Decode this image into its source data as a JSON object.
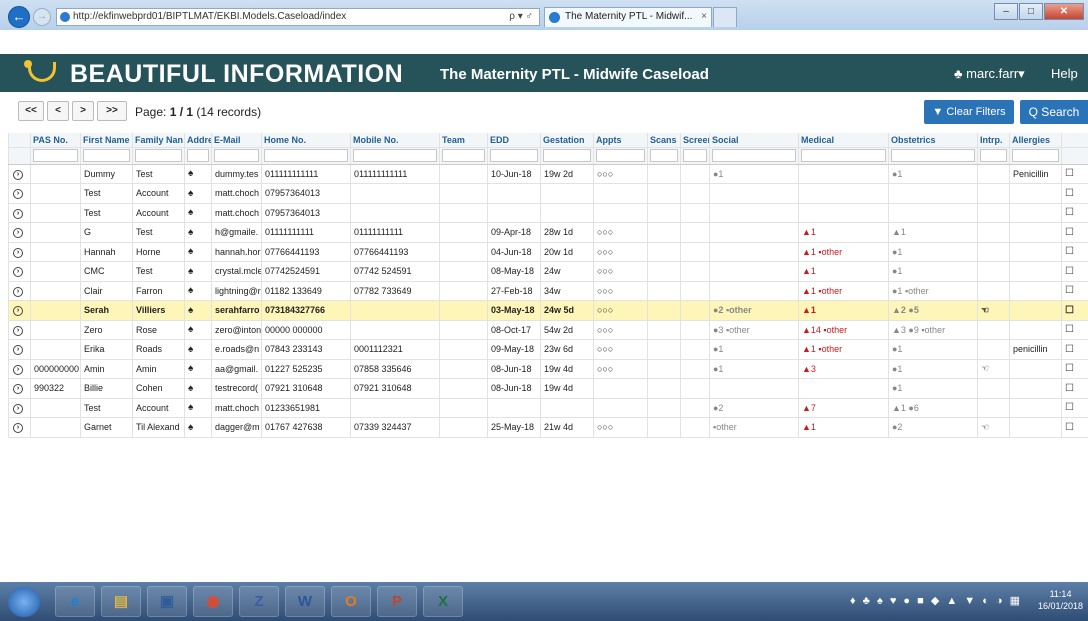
{
  "browser": {
    "url": "http://ekfinwebprd01/BIPTLMAT/EKBI.Models.Caseload/index",
    "tab_title": "The Maternity PTL - Midwif...",
    "address_controls": "ρ ▾ ♂",
    "tab_close": "×",
    "window_buttons": {
      "minimize": "–",
      "maximize": "□",
      "close": "✕"
    }
  },
  "app": {
    "brand": "BEAUTIFUL INFORMATION",
    "subtitle": "The Maternity PTL - Midwife Caseload",
    "user": "♣ marc.farr▾",
    "help": "Help"
  },
  "pager": {
    "first": "<<",
    "prev": "<",
    "next": ">",
    "last": ">>",
    "page_label": "Page:",
    "page_value": "1 / 1",
    "records": "(14 records)"
  },
  "toolbar": {
    "clear_filters": "▼ Clear Filters",
    "search": "Q Search"
  },
  "columns": [
    "",
    "PAS No.",
    "First Name",
    "Family Nan",
    "Addres",
    "E-Mail",
    "Home No.",
    "Mobile No.",
    "Team",
    "EDD",
    "Gestation",
    "Appts",
    "Scans",
    "Screen",
    "Social",
    "Medical",
    "Obstetrics",
    "Intrp.",
    "Allergies",
    ""
  ],
  "rows": [
    {
      "pas": "",
      "first": "Dummy",
      "family": "Test",
      "email": "dummy.tes",
      "home": "011111111111",
      "mobile": "011111111111",
      "edd": "10-Jun-18",
      "gest": "19w 2d",
      "appts": "○○○",
      "social": "●1",
      "medical": "",
      "obstetrics": "●1",
      "intrp": "",
      "allergies": "Penicillin",
      "highlight": false
    },
    {
      "pas": "",
      "first": "Test",
      "family": "Account",
      "email": "matt.choch",
      "home": "07957364013",
      "mobile": "",
      "edd": "",
      "gest": "",
      "appts": "",
      "social": "",
      "medical": "",
      "obstetrics": "",
      "intrp": "",
      "allergies": "",
      "highlight": false
    },
    {
      "pas": "",
      "first": "Test",
      "family": "Account",
      "email": "matt.choch",
      "home": "07957364013",
      "mobile": "",
      "edd": "",
      "gest": "",
      "appts": "",
      "social": "",
      "medical": "",
      "obstetrics": "",
      "intrp": "",
      "allergies": "",
      "highlight": false
    },
    {
      "pas": "",
      "first": "G",
      "family": "Test",
      "email": "h@gmaile.",
      "home": "01111111111",
      "mobile": "01111111111",
      "edd": "09-Apr-18",
      "gest": "28w 1d",
      "appts": "○○○",
      "social": "",
      "medical": "▲1",
      "obstetrics": "▲1",
      "intrp": "",
      "allergies": "",
      "highlight": false
    },
    {
      "pas": "",
      "first": "Hannah",
      "family": "Horne",
      "email": "hannah.hor",
      "home": "07766441193",
      "mobile": "07766441193",
      "edd": "04-Jun-18",
      "gest": "20w 1d",
      "appts": "○○○",
      "social": "",
      "medical": "▲1  ▪other",
      "obstetrics": "●1",
      "intrp": "",
      "allergies": "",
      "highlight": false
    },
    {
      "pas": "",
      "first": "CMC",
      "family": "Test",
      "email": "crystal.mcle",
      "home": "07742524591",
      "mobile": "07742 524591",
      "edd": "08-May-18",
      "gest": "24w",
      "appts": "○○○",
      "social": "",
      "medical": "▲1",
      "obstetrics": "●1",
      "intrp": "",
      "allergies": "",
      "highlight": false
    },
    {
      "pas": "",
      "first": "Clair",
      "family": "Farron",
      "email": "lightning@r",
      "home": "01182 133649",
      "mobile": "07782 733649",
      "edd": "27-Feb-18",
      "gest": "34w",
      "appts": "○○○",
      "social": "",
      "medical": "▲1  ▪other",
      "obstetrics": "●1 ▪other",
      "intrp": "",
      "allergies": "",
      "highlight": false
    },
    {
      "pas": "",
      "first": "Serah",
      "family": "Villiers",
      "email": "serahfarro",
      "home": "073184327766",
      "mobile": "",
      "edd": "03-May-18",
      "gest": "24w 5d",
      "appts": "○○○",
      "social": "●2 ▪other",
      "medical": "▲1",
      "obstetrics": "▲2 ●5",
      "intrp": "☜",
      "allergies": "",
      "highlight": true
    },
    {
      "pas": "",
      "first": "Zero",
      "family": "Rose",
      "email": "zero@inton",
      "home": "00000 000000",
      "mobile": "",
      "edd": "08-Oct-17",
      "gest": "54w 2d",
      "appts": "○○○",
      "social": "●3 ▪other",
      "medical": "▲14  ▪other",
      "obstetrics": "▲3 ●9 ▪other",
      "intrp": "",
      "allergies": "",
      "highlight": false
    },
    {
      "pas": "",
      "first": "Erika",
      "family": "Roads",
      "email": "e.roads@n",
      "home": "07843 233143",
      "mobile": "0001112321",
      "edd": "09-May-18",
      "gest": "23w 6d",
      "appts": "○○○",
      "social": "●1",
      "medical": "▲1  ▪other",
      "obstetrics": "●1",
      "intrp": "",
      "allergies": "penicillin",
      "highlight": false
    },
    {
      "pas": "000000000",
      "first": "Amin",
      "family": "Amin",
      "email": "aa@gmail.",
      "home": "01227 525235",
      "mobile": "07858 335646",
      "edd": "08-Jun-18",
      "gest": "19w 4d",
      "appts": "○○○",
      "social": "●1",
      "medical": "▲3",
      "obstetrics": "●1",
      "intrp": "☜",
      "allergies": "",
      "highlight": false
    },
    {
      "pas": "990322",
      "first": "Billie",
      "family": "Cohen",
      "email": "testrecord(",
      "home": "07921 310648",
      "mobile": "07921 310648",
      "edd": "08-Jun-18",
      "gest": "19w 4d",
      "appts": "",
      "social": "",
      "medical": "",
      "obstetrics": "●1",
      "intrp": "",
      "allergies": "",
      "highlight": false
    },
    {
      "pas": "",
      "first": "Test",
      "family": "Account",
      "email": "matt.choch",
      "home": "01233651981",
      "mobile": "",
      "edd": "",
      "gest": "",
      "appts": "",
      "social": "●2",
      "medical": "▲7",
      "obstetrics": "▲1 ●6",
      "intrp": "",
      "allergies": "",
      "highlight": false
    },
    {
      "pas": "",
      "first": "Garnet",
      "family": "Til Alexand",
      "email": "dagger@m",
      "home": "01767 427638",
      "mobile": "07339 324437",
      "edd": "25-May-18",
      "gest": "21w 4d",
      "appts": "○○○",
      "social": "▪other",
      "medical": "▲1",
      "obstetrics": "●2",
      "intrp": "☜",
      "allergies": "",
      "highlight": false
    }
  ],
  "row_symbols": {
    "expand": "⊕",
    "address": "♠",
    "comment": "☐"
  },
  "taskbar": {
    "apps": [
      "e",
      "▤",
      "▣",
      "◉",
      "Z",
      "W",
      "O",
      "P",
      "X"
    ],
    "tray": "♦ ♣ ♠ ♥ ● ■ ◆ ▲ ▼ ◐ ◑ ▦",
    "time": "11:14",
    "date": "16/01/2018"
  },
  "colors": {
    "banner": "#255359",
    "accent": "#2b73b7",
    "highlight": "#fdf6b8",
    "alert": "#d0191c"
  }
}
